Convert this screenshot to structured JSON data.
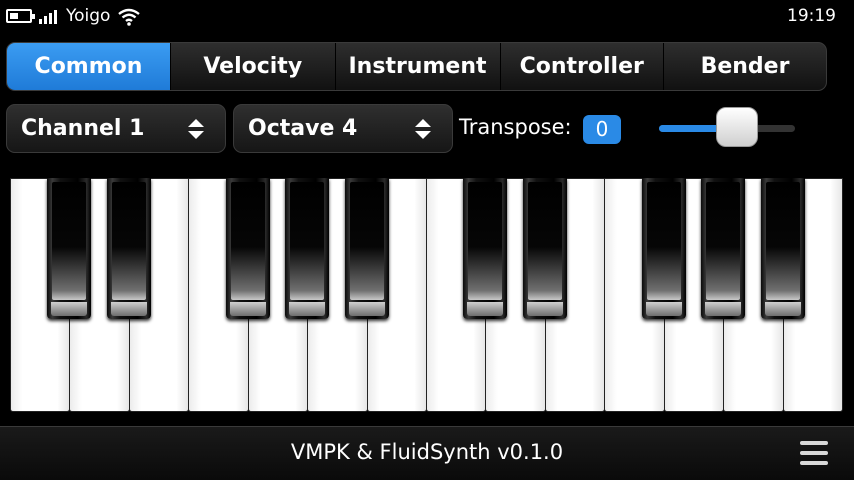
{
  "status_bar": {
    "carrier": "Yoigo",
    "time": "19:19",
    "icons": [
      "battery-icon",
      "signal-icon",
      "wifi-icon"
    ]
  },
  "tabs": [
    {
      "label": "Common",
      "active": true
    },
    {
      "label": "Velocity",
      "active": false
    },
    {
      "label": "Instrument",
      "active": false
    },
    {
      "label": "Controller",
      "active": false
    },
    {
      "label": "Bender",
      "active": false
    }
  ],
  "controls": {
    "channel": "Channel 1",
    "octave": "Octave 4",
    "transpose_label": "Transpose:",
    "transpose_value": "0",
    "transpose_slider_fraction": 0.5
  },
  "piano": {
    "white_keys": 14,
    "black_keys": 10
  },
  "footer": {
    "title": "VMPK & FluidSynth v0.1.0",
    "menu_icon": "menu-icon"
  },
  "colors": {
    "accent": "#2a8ae6",
    "background": "#000000"
  }
}
